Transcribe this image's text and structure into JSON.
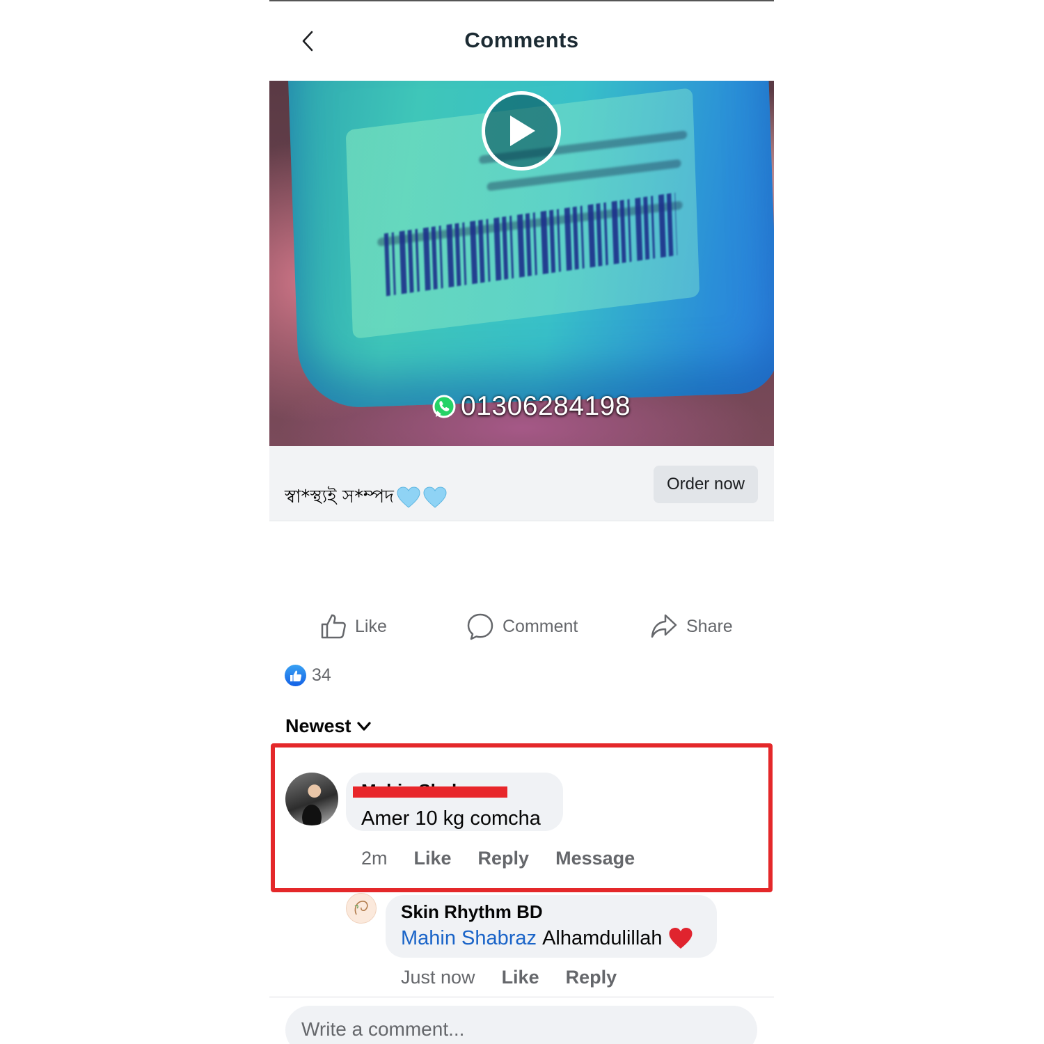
{
  "header": {
    "title": "Comments"
  },
  "video": {
    "overlay_phone": "01306284198"
  },
  "ad": {
    "caption": "স্বা*স্থ্যই স*ম্পদ",
    "order_button": "Order now"
  },
  "actions": {
    "like": "Like",
    "comment": "Comment",
    "share": "Share"
  },
  "reactions": {
    "count": "34"
  },
  "sort": {
    "label": "Newest"
  },
  "comments": [
    {
      "author": "Mahin Shabraz",
      "text": "Amer 10 kg comcha",
      "time": "2m",
      "actions": [
        "Like",
        "Reply",
        "Message"
      ]
    },
    {
      "author": "Skin Rhythm BD",
      "mention": "Mahin Shabraz",
      "text": "Alhamdulillah",
      "time": "Just now",
      "actions": [
        "Like",
        "Reply"
      ]
    }
  ],
  "composer": {
    "placeholder": "Write a comment..."
  },
  "colors": {
    "highlight": "#e4282a",
    "mention": "#1a64c8",
    "bubble": "#f0f2f5",
    "meta_text": "#65676b"
  }
}
